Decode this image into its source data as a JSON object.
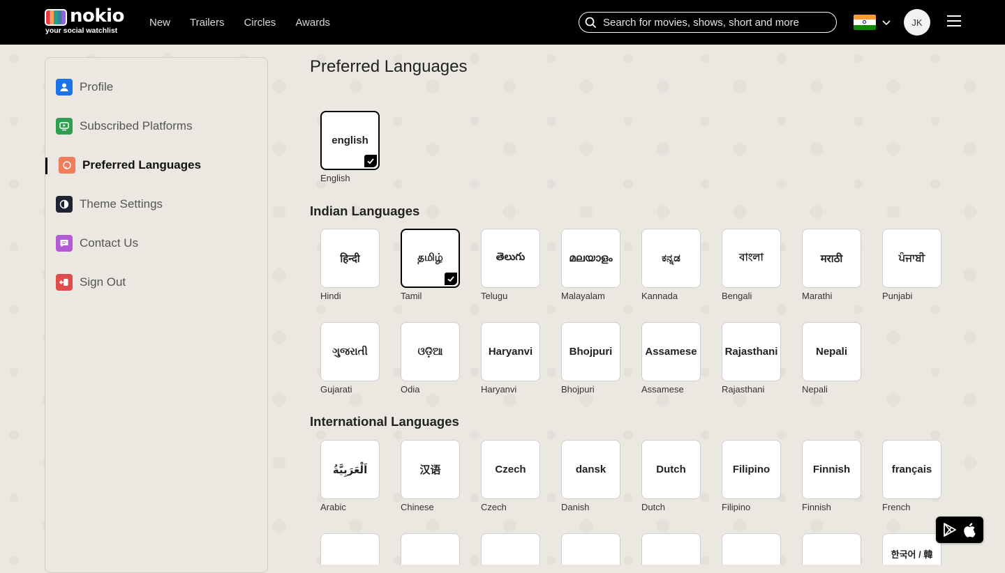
{
  "header": {
    "logo_text": "nokio",
    "logo_tagline": "your social watchlist",
    "nav": [
      "New",
      "Trailers",
      "Circles",
      "Awards"
    ],
    "search_placeholder": "Search for movies, shows, short and more",
    "avatar_initials": "JK"
  },
  "sidebar": {
    "items": [
      {
        "label": "Profile",
        "color": "#1a73e8"
      },
      {
        "label": "Subscribed Platforms",
        "color": "#2e9e4f"
      },
      {
        "label": "Preferred Languages",
        "color": "#f07c5a"
      },
      {
        "label": "Theme Settings",
        "color": "#1f2433"
      },
      {
        "label": "Contact Us",
        "color": "#b45ad6"
      },
      {
        "label": "Sign Out",
        "color": "#e24c4c"
      }
    ]
  },
  "main": {
    "title": "Preferred Languages",
    "primary": [
      {
        "native": "english",
        "name": "English",
        "selected": true
      }
    ],
    "indian_title": "Indian Languages",
    "indian": [
      {
        "native": "हिन्दी",
        "name": "Hindi",
        "selected": false
      },
      {
        "native": "தமிழ்",
        "name": "Tamil",
        "selected": true
      },
      {
        "native": "తెలుగు",
        "name": "Telugu",
        "selected": false
      },
      {
        "native": "മലയാളം",
        "name": "Malayalam",
        "selected": false
      },
      {
        "native": "ಕನ್ನಡ",
        "name": "Kannada",
        "selected": false
      },
      {
        "native": "বাংলা",
        "name": "Bengali",
        "selected": false
      },
      {
        "native": "मराठी",
        "name": "Marathi",
        "selected": false
      },
      {
        "native": "ਪੰਜਾਬੀ",
        "name": "Punjabi",
        "selected": false
      },
      {
        "native": "ગુજરાતી",
        "name": "Gujarati",
        "selected": false
      },
      {
        "native": "ଓଡ଼ିଆ",
        "name": "Odia",
        "selected": false
      },
      {
        "native": "Haryanvi",
        "name": "Haryanvi",
        "selected": false
      },
      {
        "native": "Bhojpuri",
        "name": "Bhojpuri",
        "selected": false
      },
      {
        "native": "Assamese",
        "name": "Assamese",
        "selected": false
      },
      {
        "native": "Rajasthani",
        "name": "Rajasthani",
        "selected": false
      },
      {
        "native": "Nepali",
        "name": "Nepali",
        "selected": false
      }
    ],
    "international_title": "International Languages",
    "international": [
      {
        "native": "اَلْعَرَبِيَّةُ",
        "name": "Arabic",
        "selected": false
      },
      {
        "native": "汉语",
        "name": "Chinese",
        "selected": false
      },
      {
        "native": "Czech",
        "name": "Czech",
        "selected": false
      },
      {
        "native": "dansk",
        "name": "Danish",
        "selected": false
      },
      {
        "native": "Dutch",
        "name": "Dutch",
        "selected": false
      },
      {
        "native": "Filipino",
        "name": "Filipino",
        "selected": false
      },
      {
        "native": "Finnish",
        "name": "Finnish",
        "selected": false
      },
      {
        "native": "français",
        "name": "French",
        "selected": false
      }
    ],
    "partial_row_last": "한국어 / 韓"
  }
}
